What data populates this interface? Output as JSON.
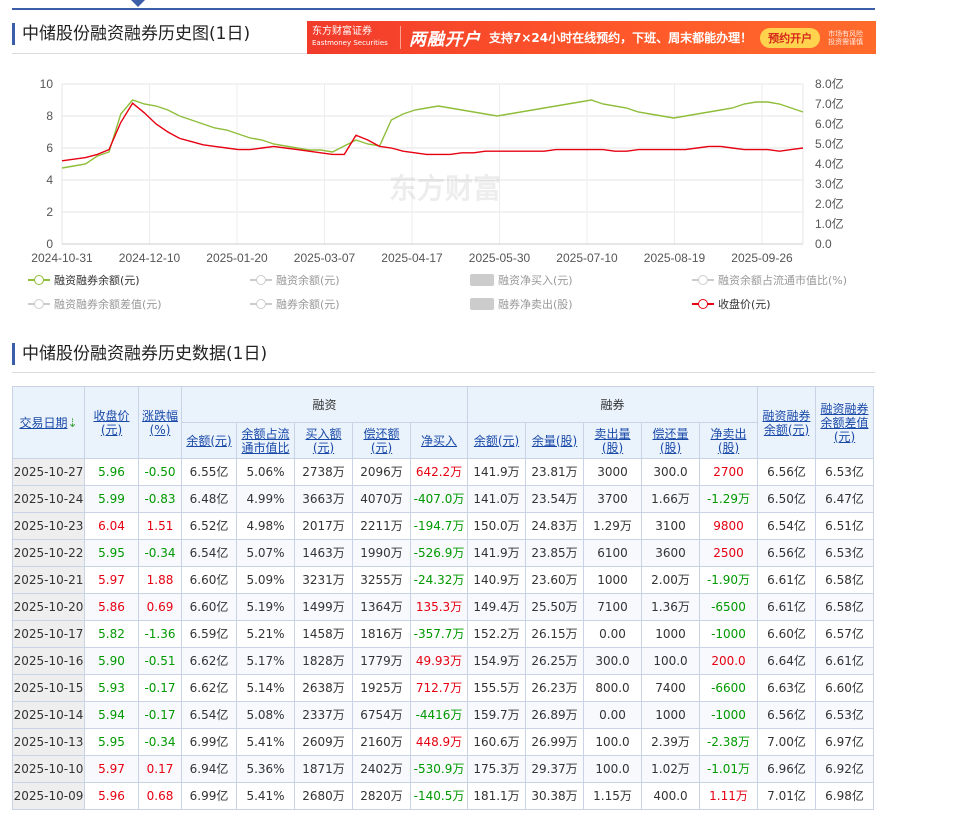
{
  "chart_section": {
    "title": "中储股份融资融券历史图(1日)"
  },
  "banner": {
    "logo": "东方财富证券",
    "logo_en": "Eastmoney Securities",
    "headline": "两融开户",
    "text": "支持7×24小时在线预约，下班、周末都能办理！",
    "button": "预约开户",
    "note": "市场有风险 投资需谨慎"
  },
  "chart_data": {
    "type": "line",
    "x_ticks": [
      "2024-10-31",
      "2024-12-10",
      "2025-01-20",
      "2025-03-07",
      "2025-04-17",
      "2025-05-30",
      "2025-07-10",
      "2025-08-19",
      "2025-09-26"
    ],
    "y_left_ticks": [
      "0",
      "2",
      "4",
      "6",
      "8",
      "10"
    ],
    "y_right_ticks": [
      "0.0",
      "1.0亿",
      "2.0亿",
      "3.0亿",
      "4.0亿",
      "5.0亿",
      "6.0亿",
      "7.0亿",
      "8.0亿"
    ],
    "ylim_left": [
      0,
      10
    ],
    "ylim_right": [
      0,
      8
    ],
    "watermark": "东方财富",
    "grid": true,
    "series": [
      {
        "name": "融资融券余额(元)",
        "axis": "right",
        "color": "#8fbe3a",
        "values": [
          3.8,
          3.9,
          4.0,
          4.4,
          4.6,
          6.5,
          7.2,
          7.0,
          6.9,
          6.7,
          6.4,
          6.2,
          6.0,
          5.8,
          5.7,
          5.5,
          5.3,
          5.2,
          5.0,
          4.9,
          4.8,
          4.7,
          4.7,
          4.6,
          4.9,
          5.2,
          5.0,
          4.9,
          6.2,
          6.5,
          6.7,
          6.8,
          6.9,
          6.8,
          6.7,
          6.6,
          6.5,
          6.4,
          6.5,
          6.6,
          6.7,
          6.8,
          6.9,
          7.0,
          7.1,
          7.2,
          7.0,
          6.9,
          6.8,
          6.6,
          6.5,
          6.4,
          6.3,
          6.4,
          6.5,
          6.6,
          6.7,
          6.8,
          7.0,
          7.1,
          7.1,
          7.0,
          6.8,
          6.6
        ]
      },
      {
        "name": "收盘价(元)",
        "axis": "left",
        "color": "#e60012",
        "values": [
          5.2,
          5.3,
          5.4,
          5.6,
          5.9,
          7.6,
          8.8,
          8.2,
          7.5,
          7.0,
          6.6,
          6.4,
          6.2,
          6.1,
          6.0,
          5.9,
          5.9,
          6.0,
          6.1,
          6.0,
          5.9,
          5.8,
          5.7,
          5.6,
          5.6,
          6.8,
          6.5,
          6.1,
          6.0,
          5.8,
          5.7,
          5.6,
          5.6,
          5.6,
          5.7,
          5.7,
          5.8,
          5.8,
          5.8,
          5.8,
          5.8,
          5.8,
          5.9,
          5.9,
          5.9,
          5.9,
          5.9,
          5.8,
          5.8,
          5.9,
          5.9,
          5.9,
          5.9,
          5.9,
          6.0,
          6.1,
          6.1,
          6.0,
          5.9,
          5.9,
          5.9,
          5.8,
          5.9,
          6.0
        ]
      }
    ],
    "legend": [
      {
        "label": "融资融券余额(元)",
        "active": true,
        "color": "#8fbe3a",
        "kind": "line"
      },
      {
        "label": "融资余额(元)",
        "active": false,
        "color": "#cccccc",
        "kind": "line"
      },
      {
        "label": "融资净买入(元)",
        "active": false,
        "color": "#cccccc",
        "kind": "box"
      },
      {
        "label": "融资余额占流通市值比(%)",
        "active": false,
        "color": "#cccccc",
        "kind": "line"
      },
      {
        "label": "融资融券余额差值(元)",
        "active": false,
        "color": "#cccccc",
        "kind": "line"
      },
      {
        "label": "融券余额(元)",
        "active": false,
        "color": "#cccccc",
        "kind": "line"
      },
      {
        "label": "融券净卖出(股)",
        "active": false,
        "color": "#cccccc",
        "kind": "box"
      },
      {
        "label": "收盘价(元)",
        "active": true,
        "color": "#e60012",
        "kind": "line"
      }
    ]
  },
  "table_section": {
    "title": "中储股份融资融券历史数据(1日)"
  },
  "table": {
    "group_rz": "融资",
    "group_rq": "融券",
    "h_date": "交易日期",
    "h_close": "收盘价(元)",
    "h_change": "涨跌幅(%)",
    "h_rzye": "余额(元)",
    "h_rzzb": "余额占流通市值比",
    "h_rzmr": "买入额(元)",
    "h_rzch": "偿还额(元)",
    "h_rzjmr": "净买入",
    "h_rqye": "余额(元)",
    "h_rqyl": "余量(股)",
    "h_rqmc": "卖出量(股)",
    "h_rqch": "偿还量(股)",
    "h_rqjmc": "净卖出(股)",
    "h_rzrqye": "融资融券余额(元)",
    "h_rzrqcz": "融资融券余额差值(元)",
    "rows": [
      {
        "date": "2025-10-27",
        "close": "5.96",
        "chg": "-0.50",
        "rzye": "6.55亿",
        "rzzb": "5.06%",
        "rzmr": "2738万",
        "rzch": "2096万",
        "rzjmr": "642.2万",
        "rqye": "141.9万",
        "rqyl": "23.81万",
        "rqmc": "3000",
        "rqch": "300.0",
        "rqjmc": "2700",
        "rzrqye": "6.56亿",
        "rzrqcz": "6.53亿",
        "c_close": "dn",
        "c_chg": "dn",
        "c_jmr": "up",
        "c_jmc": "up"
      },
      {
        "date": "2025-10-24",
        "close": "5.99",
        "chg": "-0.83",
        "rzye": "6.48亿",
        "rzzb": "4.99%",
        "rzmr": "3663万",
        "rzch": "4070万",
        "rzjmr": "-407.0万",
        "rqye": "141.0万",
        "rqyl": "23.54万",
        "rqmc": "3700",
        "rqch": "1.66万",
        "rqjmc": "-1.29万",
        "rzrqye": "6.50亿",
        "rzrqcz": "6.47亿",
        "c_close": "dn",
        "c_chg": "dn",
        "c_jmr": "dn",
        "c_jmc": "dn"
      },
      {
        "date": "2025-10-23",
        "close": "6.04",
        "chg": "1.51",
        "rzye": "6.52亿",
        "rzzb": "4.98%",
        "rzmr": "2017万",
        "rzch": "2211万",
        "rzjmr": "-194.7万",
        "rqye": "150.0万",
        "rqyl": "24.83万",
        "rqmc": "1.29万",
        "rqch": "3100",
        "rqjmc": "9800",
        "rzrqye": "6.54亿",
        "rzrqcz": "6.51亿",
        "c_close": "up",
        "c_chg": "up",
        "c_jmr": "dn",
        "c_jmc": "up"
      },
      {
        "date": "2025-10-22",
        "close": "5.95",
        "chg": "-0.34",
        "rzye": "6.54亿",
        "rzzb": "5.07%",
        "rzmr": "1463万",
        "rzch": "1990万",
        "rzjmr": "-526.9万",
        "rqye": "141.9万",
        "rqyl": "23.85万",
        "rqmc": "6100",
        "rqch": "3600",
        "rqjmc": "2500",
        "rzrqye": "6.56亿",
        "rzrqcz": "6.53亿",
        "c_close": "dn",
        "c_chg": "dn",
        "c_jmr": "dn",
        "c_jmc": "up"
      },
      {
        "date": "2025-10-21",
        "close": "5.97",
        "chg": "1.88",
        "rzye": "6.60亿",
        "rzzb": "5.09%",
        "rzmr": "3231万",
        "rzch": "3255万",
        "rzjmr": "-24.32万",
        "rqye": "140.9万",
        "rqyl": "23.60万",
        "rqmc": "1000",
        "rqch": "2.00万",
        "rqjmc": "-1.90万",
        "rzrqye": "6.61亿",
        "rzrqcz": "6.58亿",
        "c_close": "up",
        "c_chg": "up",
        "c_jmr": "dn",
        "c_jmc": "dn"
      },
      {
        "date": "2025-10-20",
        "close": "5.86",
        "chg": "0.69",
        "rzye": "6.60亿",
        "rzzb": "5.19%",
        "rzmr": "1499万",
        "rzch": "1364万",
        "rzjmr": "135.3万",
        "rqye": "149.4万",
        "rqyl": "25.50万",
        "rqmc": "7100",
        "rqch": "1.36万",
        "rqjmc": "-6500",
        "rzrqye": "6.61亿",
        "rzrqcz": "6.58亿",
        "c_close": "up",
        "c_chg": "up",
        "c_jmr": "up",
        "c_jmc": "dn"
      },
      {
        "date": "2025-10-17",
        "close": "5.82",
        "chg": "-1.36",
        "rzye": "6.59亿",
        "rzzb": "5.21%",
        "rzmr": "1458万",
        "rzch": "1816万",
        "rzjmr": "-357.7万",
        "rqye": "152.2万",
        "rqyl": "26.15万",
        "rqmc": "0.00",
        "rqch": "1000",
        "rqjmc": "-1000",
        "rzrqye": "6.60亿",
        "rzrqcz": "6.57亿",
        "c_close": "dn",
        "c_chg": "dn",
        "c_jmr": "dn",
        "c_jmc": "dn"
      },
      {
        "date": "2025-10-16",
        "close": "5.90",
        "chg": "-0.51",
        "rzye": "6.62亿",
        "rzzb": "5.17%",
        "rzmr": "1828万",
        "rzch": "1779万",
        "rzjmr": "49.93万",
        "rqye": "154.9万",
        "rqyl": "26.25万",
        "rqmc": "300.0",
        "rqch": "100.0",
        "rqjmc": "200.0",
        "rzrqye": "6.64亿",
        "rzrqcz": "6.61亿",
        "c_close": "dn",
        "c_chg": "dn",
        "c_jmr": "up",
        "c_jmc": "up"
      },
      {
        "date": "2025-10-15",
        "close": "5.93",
        "chg": "-0.17",
        "rzye": "6.62亿",
        "rzzb": "5.14%",
        "rzmr": "2638万",
        "rzch": "1925万",
        "rzjmr": "712.7万",
        "rqye": "155.5万",
        "rqyl": "26.23万",
        "rqmc": "800.0",
        "rqch": "7400",
        "rqjmc": "-6600",
        "rzrqye": "6.63亿",
        "rzrqcz": "6.60亿",
        "c_close": "dn",
        "c_chg": "dn",
        "c_jmr": "up",
        "c_jmc": "dn"
      },
      {
        "date": "2025-10-14",
        "close": "5.94",
        "chg": "-0.17",
        "rzye": "6.54亿",
        "rzzb": "5.08%",
        "rzmr": "2337万",
        "rzch": "6754万",
        "rzjmr": "-4416万",
        "rqye": "159.7万",
        "rqyl": "26.89万",
        "rqmc": "0.00",
        "rqch": "1000",
        "rqjmc": "-1000",
        "rzrqye": "6.56亿",
        "rzrqcz": "6.53亿",
        "c_close": "dn",
        "c_chg": "dn",
        "c_jmr": "dn",
        "c_jmc": "dn"
      },
      {
        "date": "2025-10-13",
        "close": "5.95",
        "chg": "-0.34",
        "rzye": "6.99亿",
        "rzzb": "5.41%",
        "rzmr": "2609万",
        "rzch": "2160万",
        "rzjmr": "448.9万",
        "rqye": "160.6万",
        "rqyl": "26.99万",
        "rqmc": "100.0",
        "rqch": "2.39万",
        "rqjmc": "-2.38万",
        "rzrqye": "7.00亿",
        "rzrqcz": "6.97亿",
        "c_close": "dn",
        "c_chg": "dn",
        "c_jmr": "up",
        "c_jmc": "dn"
      },
      {
        "date": "2025-10-10",
        "close": "5.97",
        "chg": "0.17",
        "rzye": "6.94亿",
        "rzzb": "5.36%",
        "rzmr": "1871万",
        "rzch": "2402万",
        "rzjmr": "-530.9万",
        "rqye": "175.3万",
        "rqyl": "29.37万",
        "rqmc": "100.0",
        "rqch": "1.02万",
        "rqjmc": "-1.01万",
        "rzrqye": "6.96亿",
        "rzrqcz": "6.92亿",
        "c_close": "up",
        "c_chg": "up",
        "c_jmr": "dn",
        "c_jmc": "dn"
      },
      {
        "date": "2025-10-09",
        "close": "5.96",
        "chg": "0.68",
        "rzye": "6.99亿",
        "rzzb": "5.41%",
        "rzmr": "2680万",
        "rzch": "2820万",
        "rzjmr": "-140.5万",
        "rqye": "181.1万",
        "rqyl": "30.38万",
        "rqmc": "1.15万",
        "rqch": "400.0",
        "rqjmc": "1.11万",
        "rzrqye": "7.01亿",
        "rzrqcz": "6.98亿",
        "c_close": "up",
        "c_chg": "up",
        "c_jmr": "dn",
        "c_jmc": "up"
      }
    ]
  }
}
